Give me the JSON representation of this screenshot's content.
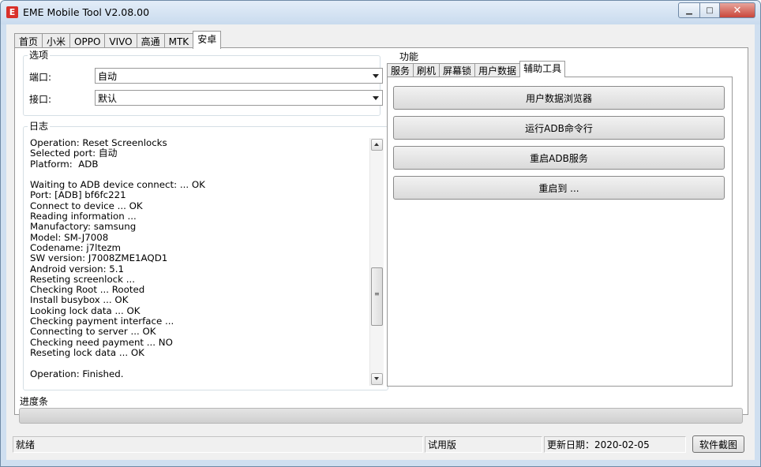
{
  "window": {
    "icon_letter": "E",
    "title": "EME Mobile Tool V2.08.00",
    "min_symbol": "▁",
    "max_symbol": "□",
    "close_symbol": "✕"
  },
  "tabs": [
    "首页",
    "小米",
    "OPPO",
    "VIVO",
    "高通",
    "MTK",
    "安卓"
  ],
  "active_tab": "安卓",
  "options": {
    "title": "选项",
    "port_label": "端口:",
    "port_value": "自动",
    "interface_label": "接口:",
    "interface_value": "默认"
  },
  "log": {
    "title": "日志",
    "lines": [
      "Operation: Reset Screenlocks",
      "Selected port: 自动",
      "Platform:  ADB",
      "",
      "Waiting to ADB device connect: ... OK",
      "Port: [ADB] bf6fc221",
      "Connect to device ... OK",
      "Reading information ...",
      "Manufactory: samsung",
      "Model: SM-J7008",
      "Codename: j7ltezm",
      "SW version: J7008ZME1AQD1",
      "Android version: 5.1",
      "Reseting screenlock ...",
      "Checking Root ... Rooted",
      "Install busybox ... OK",
      "Looking lock data ... OK",
      "Checking payment interface ...",
      "Connecting to server ... OK",
      "Checking need payment ... NO",
      "Reseting lock data ... OK",
      "",
      "Operation: Finished."
    ]
  },
  "functions": {
    "title": "功能",
    "subtabs": [
      "服务",
      "刷机",
      "屏幕锁",
      "用户数据",
      "辅助工具"
    ],
    "active_subtab": "辅助工具",
    "buttons": [
      "用户数据浏览器",
      "运行ADB命令行",
      "重启ADB服务",
      "重启到 ..."
    ]
  },
  "progress": {
    "title": "进度条",
    "value": 0
  },
  "statusbar": {
    "status": "就绪",
    "edition": "试用版",
    "update_date": "更新日期：2020-02-05",
    "screenshot_button": "软件截图"
  }
}
